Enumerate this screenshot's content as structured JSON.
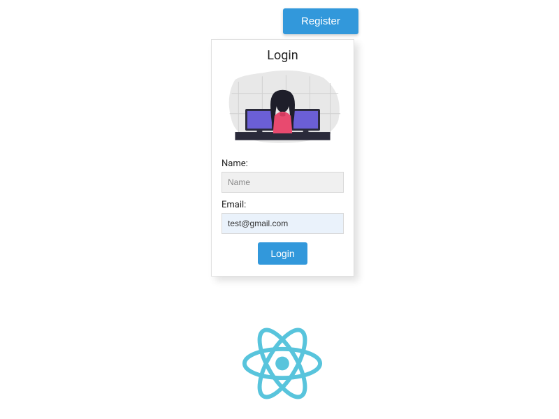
{
  "header": {
    "register_label": "Register"
  },
  "card": {
    "title": "Login",
    "name_label": "Name:",
    "name_placeholder": "Name",
    "name_value": "",
    "email_label": "Email:",
    "email_placeholder": "",
    "email_value": "test@gmail.com",
    "login_label": "Login"
  },
  "logo": {
    "name": "react-logo",
    "color": "#58c4dc"
  }
}
